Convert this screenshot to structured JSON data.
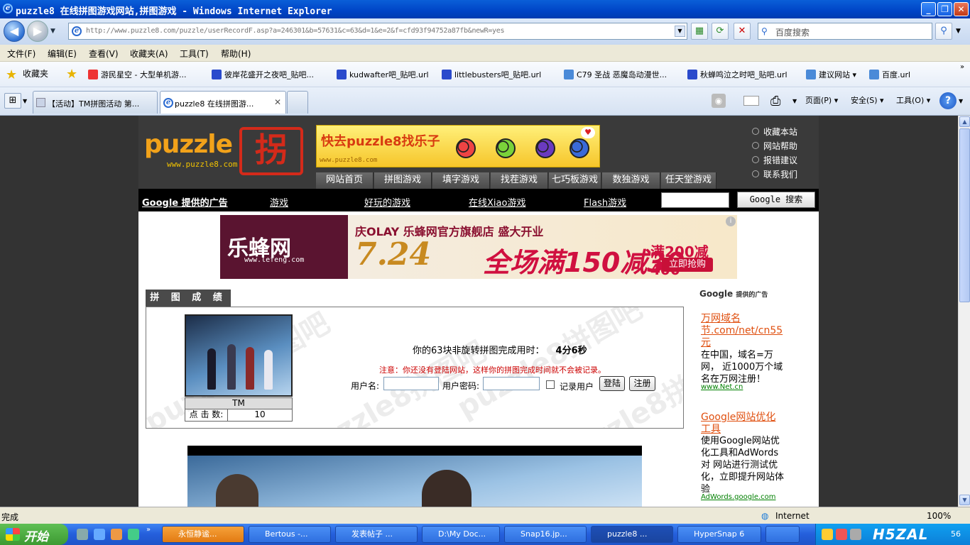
{
  "window": {
    "title": "puzzle8 在线拼图游戏网站,拼图游戏 - Windows Internet Explorer",
    "minimize": "_",
    "maximize": "❐",
    "close": "✕"
  },
  "address": {
    "url": "http://www.puzzle8.com/puzzle/userRecordF.asp?a=246301&b=57631&c=63&d=1&e=2&f=cfd93f94752a87fb&newR=yes",
    "search_placeholder": "百度搜索"
  },
  "menu": [
    "文件(F)",
    "编辑(E)",
    "查看(V)",
    "收藏夹(A)",
    "工具(T)",
    "帮助(H)"
  ],
  "favorites": {
    "label": "收藏夹",
    "items": [
      "游民星空 - 大型单机游...",
      "彼岸花盛开之夜吧_贴吧...",
      "kudwafter吧_贴吧.url",
      "littlebusters吧_贴吧.url",
      "C79 圣战 恶魔岛动漫世...",
      "秋蝉鸣泣之时吧_贴吧.url",
      "建议网站 ▾",
      "百度.url"
    ]
  },
  "tabs": [
    {
      "label": "【活动】TM拼图活动 第..."
    },
    {
      "label": "puzzle8 在线拼图游..."
    }
  ],
  "toolbar_right": {
    "page": "页面(P) ▾",
    "safety": "安全(S) ▾",
    "tools": "工具(O) ▾"
  },
  "site": {
    "logo": "puzzle",
    "logo_mark": "拐",
    "logo_url": "www.puzzle8.com",
    "banner": {
      "text": "快去puzzle8找乐子",
      "url": "www.puzzle8.com"
    },
    "header_links": [
      "收藏本站",
      "网站帮助",
      "报错建议",
      "联系我们"
    ],
    "nav": [
      "网站首页",
      "拼图游戏",
      "填字游戏",
      "找茬游戏",
      "七巧板游戏",
      "数独游戏",
      "任天堂游戏"
    ],
    "google_bar": {
      "label": "Google 提供的广告",
      "links": [
        "游戏",
        "好玩的游戏",
        "在线Xiao游戏",
        "Flash游戏"
      ],
      "button": "Google 搜索"
    },
    "ad": {
      "brand": "乐蜂网",
      "brand_url": "www.lefeng.com",
      "line1": "庆OLAY 乐蜂网官方旗舰店 盛大开业",
      "date": "7.24",
      "promo": "全场满150减30",
      "promo2": "满200减400",
      "cta": "立即抢购",
      "info": "i"
    },
    "score": {
      "heading": "拼 图 成 绩",
      "time_label": "你的63块非旋转拼图完成用时：",
      "time_value": "4分6秒",
      "notice": "注意：你还没有登陆网站，这样你的拼图完成时间就不会被记录。",
      "username_label": "用户名:",
      "password_label": "用户密码:",
      "remember_label": "记录用户",
      "login_button": "登陆",
      "register_button": "注册",
      "caption": "TM",
      "clicks_label": "点 击 数:",
      "clicks_value": "10",
      "watermark": "puzzle8拼图吧"
    },
    "side_ads": {
      "header": "Google",
      "header_small": "提供的广告",
      "items": [
        {
          "title": "万网域名节.com/net/cn55元",
          "desc": "在中国，域名=万网， 近1000万个域名在万网注册！",
          "url": "www.Net.cn"
        },
        {
          "title": "Google网站优化工具",
          "desc": "使用Google网站优化工具和AdWords对 网站进行测试优化，立即提升网站体验",
          "url": "AdWords.google.com"
        }
      ]
    }
  },
  "status": {
    "left": "完成",
    "zone": "Internet",
    "zoom": "100%"
  },
  "taskbar": {
    "start": "开始",
    "tasks": [
      "永恒静谧...",
      "Bertous -...",
      "发表帖子 ...",
      "D:\\My Doc...",
      "Snap16.jp...",
      "puzzle8 ...",
      "HyperSnap 6"
    ],
    "clock": "56",
    "overlay": "H5ZAL"
  }
}
